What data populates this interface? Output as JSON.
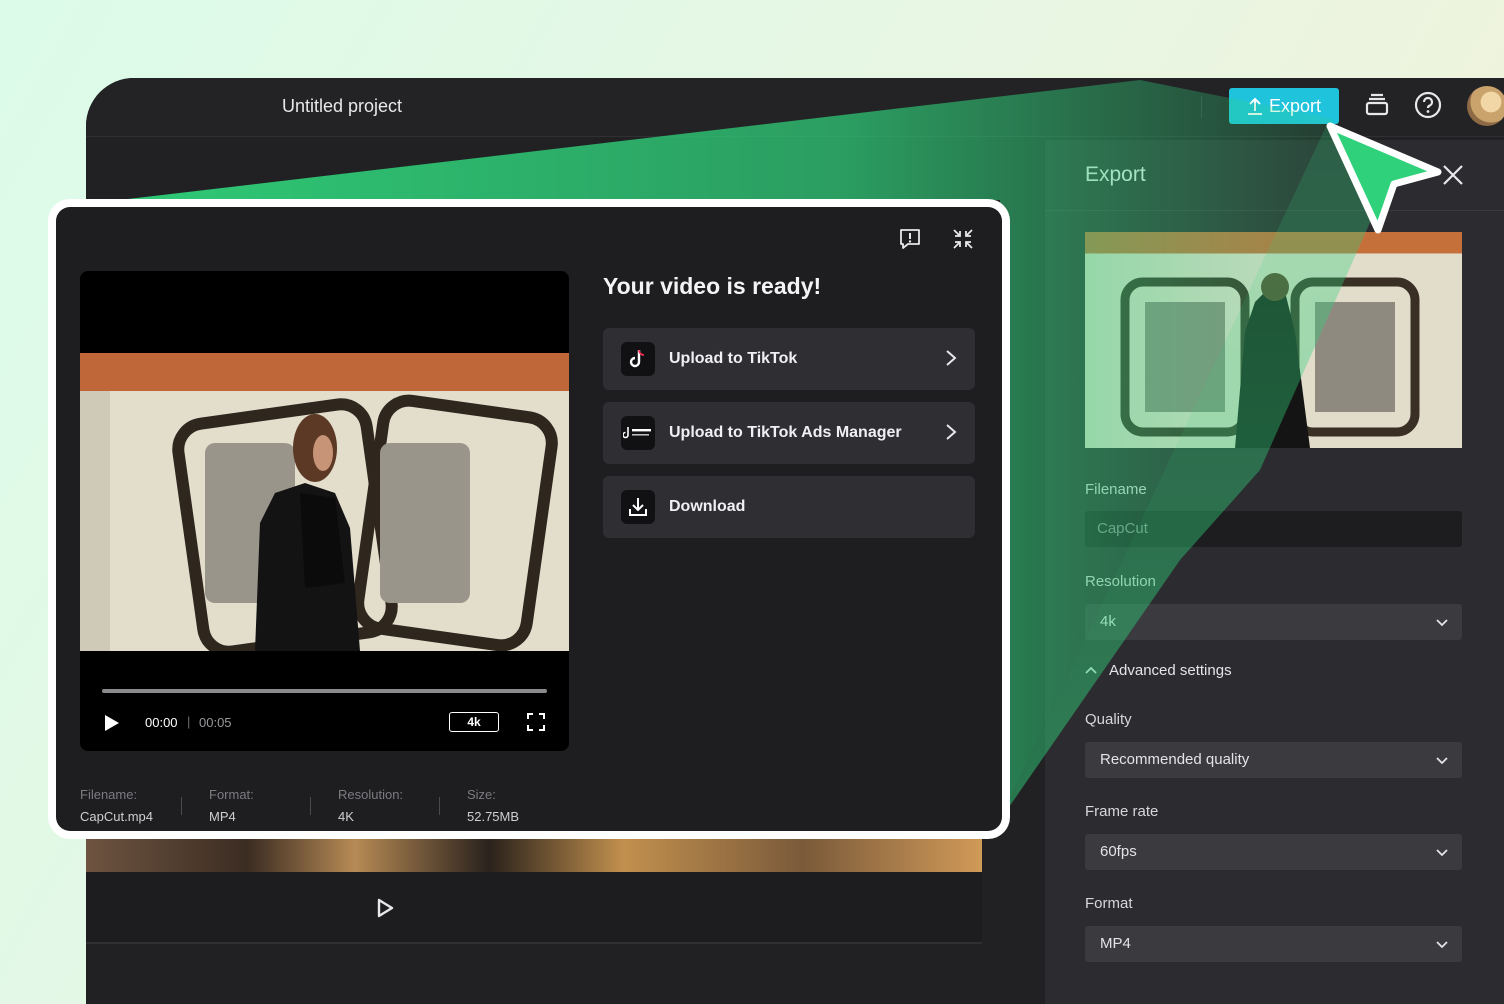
{
  "topbar": {
    "project_title": "Untitled project",
    "export_label": "Export",
    "icons": [
      "upload-icon",
      "layers-icon",
      "help-icon",
      "avatar"
    ]
  },
  "panel": {
    "title": "Export",
    "filename_label": "Filename",
    "filename_value": "CapCut",
    "resolution_label": "Resolution",
    "resolution_value": "4k",
    "advanced_label": "Advanced settings",
    "quality_label": "Quality",
    "quality_value": "Recommended quality",
    "framerate_label": "Frame rate",
    "framerate_value": "60fps",
    "format_label": "Format",
    "format_value": "MP4"
  },
  "modal": {
    "title": "Your video is ready!",
    "actions": [
      {
        "label": "Upload to TikTok",
        "icon": "tiktok-icon"
      },
      {
        "label": "Upload to TikTok Ads Manager",
        "icon": "tiktok-business-icon"
      },
      {
        "label": "Download",
        "icon": "download-icon"
      }
    ],
    "player": {
      "current_time": "00:00",
      "duration": "00:05",
      "quality": "4k"
    },
    "meta": [
      {
        "key": "Filename:",
        "value": "CapCut.mp4"
      },
      {
        "key": "Format:",
        "value": "MP4"
      },
      {
        "key": "Resolution:",
        "value": "4K"
      },
      {
        "key": "Size:",
        "value": "52.75MB"
      }
    ]
  },
  "colors": {
    "accent_export": "#1fc3dc",
    "highlight_green": "#2fd27a",
    "background": "#212124"
  }
}
